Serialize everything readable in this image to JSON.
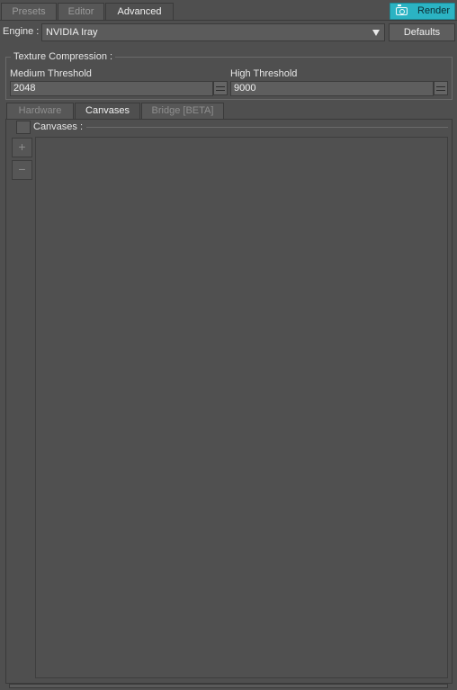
{
  "top_tabs": [
    {
      "label": "Presets",
      "active": false
    },
    {
      "label": "Editor",
      "active": false
    },
    {
      "label": "Advanced",
      "active": true
    }
  ],
  "render_button": {
    "label": "Render",
    "icon": "camera-icon",
    "color": "#2bb3c3"
  },
  "engine": {
    "label": "Engine :",
    "value": "NVIDIA Iray"
  },
  "defaults_button": {
    "label": "Defaults"
  },
  "texture_compression": {
    "title": "Texture Compression :",
    "medium": {
      "label": "Medium Threshold",
      "value": "2048"
    },
    "high": {
      "label": "High Threshold",
      "value": "9000"
    }
  },
  "sub_tabs": [
    {
      "label": "Hardware",
      "active": false
    },
    {
      "label": "Canvases",
      "active": true
    },
    {
      "label": "Bridge [BETA]",
      "active": false
    }
  ],
  "canvases": {
    "label": "Canvases :",
    "add_label": "+",
    "remove_label": "−"
  }
}
